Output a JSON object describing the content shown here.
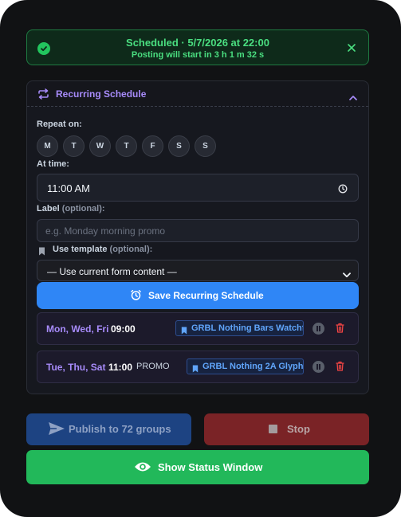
{
  "banner": {
    "title": "Scheduled · 5/7/2026 at 22:00",
    "subtitle": "Posting will start in 3 h 1 m 32 s",
    "icon": "check-circle-icon",
    "color": "#4ade80"
  },
  "recurring": {
    "title": "Recurring Schedule",
    "repeat_label": "Repeat on:",
    "days": [
      "M",
      "T",
      "W",
      "T",
      "F",
      "S",
      "S"
    ],
    "time_label": "At time:",
    "time_value": "11:00 AM",
    "label_label": "Label",
    "label_optional": "(optional):",
    "label_placeholder": "e.g. Monday morning promo",
    "template_label": "Use template",
    "template_optional": "(optional):",
    "template_selected": "— Use current form content —",
    "save_label": "Save Recurring Schedule",
    "schedules": [
      {
        "days": "Mon, Wed, Fri",
        "time": "09:00",
        "note": "",
        "template": "GRBL Nothing Bars Watchface"
      },
      {
        "days": "Tue, Thu, Sat",
        "time": "11:00",
        "note": "PROMO",
        "template": "GRBL Nothing 2A Glyph"
      }
    ]
  },
  "actions": {
    "publish_label": "Publish to 72 groups",
    "stop_label": "Stop",
    "status_label": "Show Status Window"
  },
  "colors": {
    "accent_purple": "#a78bfa",
    "primary_blue": "#2f86f6",
    "success_green": "#22b85a",
    "danger_red": "#7a2326"
  }
}
